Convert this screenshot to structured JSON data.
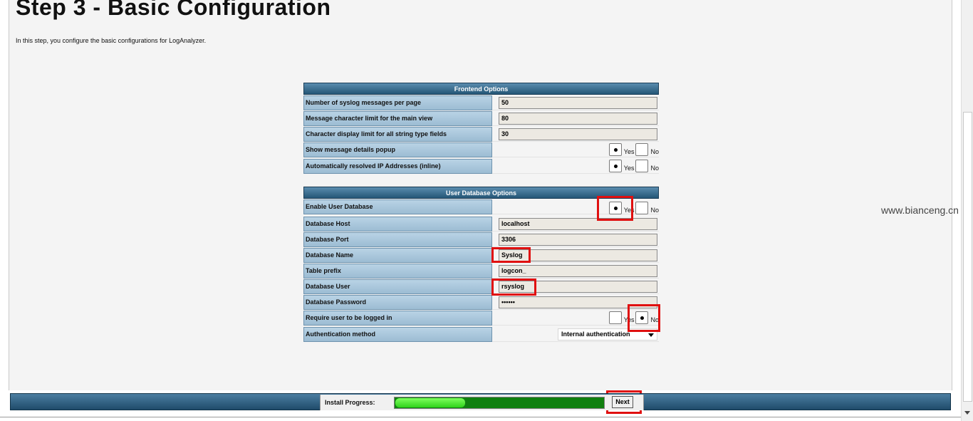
{
  "page": {
    "title": "Step 3 - Basic Configuration",
    "intro": "In this step, you configure the basic configurations for LogAnalyzer."
  },
  "frontend": {
    "header": "Frontend Options",
    "messages_per_page": {
      "label": "Number of syslog messages per page",
      "value": "50"
    },
    "char_limit_main": {
      "label": "Message character limit for the main view",
      "value": "80"
    },
    "char_limit_string": {
      "label": "Character display limit for all string type fields",
      "value": "30"
    },
    "show_popup": {
      "label": "Show message details popup",
      "yes": "Yes",
      "no": "No",
      "selected": "Yes"
    },
    "resolve_ip": {
      "label": "Automatically resolved IP Addresses (inline)",
      "yes": "Yes",
      "no": "No",
      "selected": "Yes"
    }
  },
  "userdb": {
    "header": "User Database Options",
    "enable": {
      "label": "Enable User Database",
      "yes": "Yes",
      "no": "No",
      "selected": "Yes"
    },
    "host": {
      "label": "Database Host",
      "value": "localhost"
    },
    "port": {
      "label": "Database Port",
      "value": "3306"
    },
    "name": {
      "label": "Database Name",
      "value": "Syslog"
    },
    "prefix": {
      "label": "Table prefix",
      "value": "logcon_"
    },
    "user": {
      "label": "Database User",
      "value": "rsyslog"
    },
    "password": {
      "label": "Database Password",
      "value": "••••••"
    },
    "require_login": {
      "label": "Require user to be logged in",
      "yes": "Yes",
      "no": "No",
      "selected": "No"
    },
    "auth_method": {
      "label": "Authentication method",
      "value": "Internal authentication"
    }
  },
  "footer": {
    "progress_label": "Install Progress:",
    "progress_percent": 33,
    "next_label": "Next"
  },
  "watermark": "www.bianceng.cn"
}
